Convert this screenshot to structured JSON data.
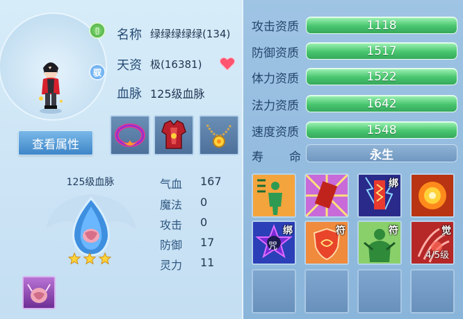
{
  "pet": {
    "name_label": "名称",
    "name_value": "绿绿绿绿绿(134)",
    "talent_label": "天资",
    "talent_value": "极(16381)",
    "bloodline_label": "血脉",
    "bloodline_value": "125级血脉",
    "badge_green": "▯",
    "badge_blue": "驭"
  },
  "view_button": "查看属性",
  "bloodline_section": {
    "title": "125级血脉",
    "stars": 3
  },
  "stats": [
    {
      "label": "气血",
      "value": "167"
    },
    {
      "label": "魔法",
      "value": "0"
    },
    {
      "label": "攻击",
      "value": "0"
    },
    {
      "label": "防御",
      "value": "17"
    },
    {
      "label": "灵力",
      "value": "11"
    }
  ],
  "attributes": [
    {
      "label": "攻击资质",
      "value": "1118"
    },
    {
      "label": "防御资质",
      "value": "1517"
    },
    {
      "label": "体力资质",
      "value": "1522"
    },
    {
      "label": "法力资质",
      "value": "1642"
    },
    {
      "label": "速度资质",
      "value": "1548"
    }
  ],
  "life": {
    "label_1": "寿",
    "label_2": "命",
    "value": "永生"
  },
  "skills_row2": [
    {
      "tag": "绑"
    },
    {
      "tag": "符"
    },
    {
      "tag": "符"
    },
    {
      "tag": "觉",
      "level": "4/5级"
    }
  ],
  "skill_row1_tag": "绑",
  "skill_icon_text": "咒",
  "colors": {
    "bar_green": "#48c56e",
    "panel_blue": "#9fc4e4",
    "label_blue": "#23456c"
  }
}
